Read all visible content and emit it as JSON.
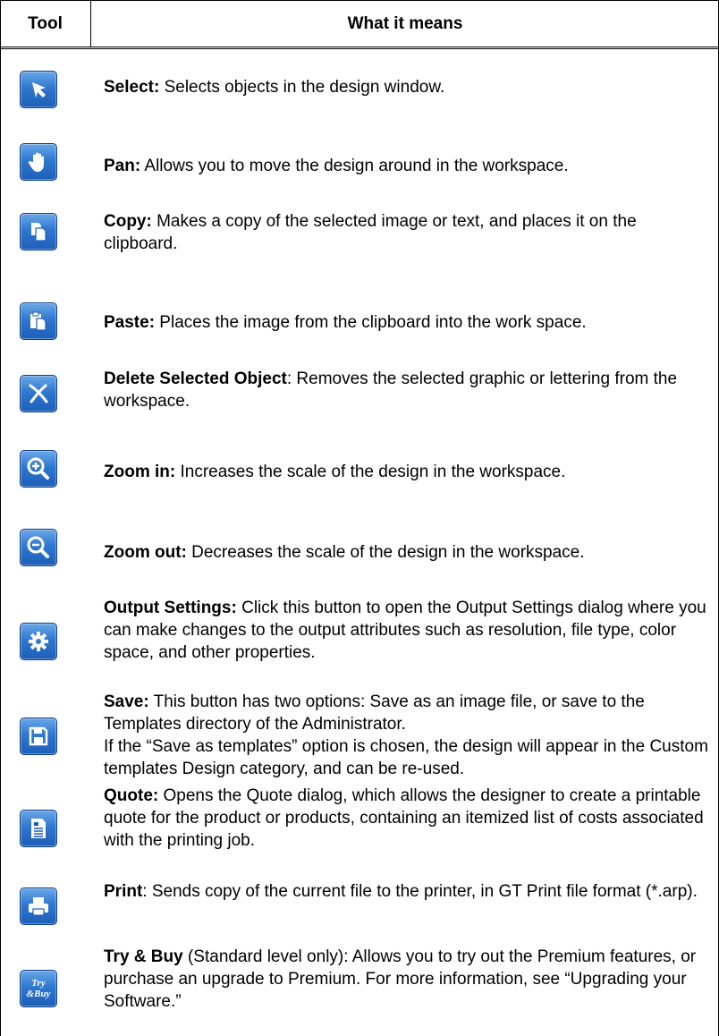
{
  "header": {
    "col1": "Tool",
    "col2": "What it means"
  },
  "rows": [
    {
      "icon": "select-arrow-icon",
      "title": "Select:",
      "text": " Selects objects in the design window."
    },
    {
      "icon": "pan-hand-icon",
      "title": "Pan:",
      "text": " Allows you to move the design around in the workspace."
    },
    {
      "icon": "copy-pages-icon",
      "title": "Copy:",
      "text": " Makes a copy of the selected image or text, and places it on the clipboard."
    },
    {
      "icon": "paste-clipboard-icon",
      "title": "Paste:",
      "text": " Places the image from the clipboard into the work space."
    },
    {
      "icon": "delete-x-icon",
      "title": "Delete Selected Object",
      "text": ": Removes the selected graphic or lettering from the workspace."
    },
    {
      "icon": "zoom-in-icon",
      "title": "Zoom in:",
      "text": " Increases the scale of the design in the workspace."
    },
    {
      "icon": "zoom-out-icon",
      "title": "Zoom out:",
      "text": " Decreases the scale of the design in the workspace."
    },
    {
      "icon": "gear-icon",
      "title": "Output Settings:",
      "text": " Click this button to open the Output Settings dialog where you can make changes to the output attributes such as resolution, file type, color space, and other properties."
    },
    {
      "icon": "floppy-disk-icon",
      "title": "Save:",
      "text": " This button has two options: Save as an image file, or save to the Templates directory of the Administrator.",
      "text2": "If the “Save as templates” option is chosen, the design will appear in the Custom templates Design category, and can be re-used."
    },
    {
      "icon": "quote-document-icon",
      "title": "Quote:",
      "text": " Opens the Quote dialog, which allows the designer to create a printable quote for the product or products, containing an itemized list of costs associated with the printing job."
    },
    {
      "icon": "printer-icon",
      "title": "Print",
      "text": ": Sends copy of the current file to the printer, in GT Print file format (*.arp)."
    },
    {
      "icon": "try-buy-icon",
      "icon_text_1": "Try",
      "icon_text_2": "&Buy",
      "title": "Try & Buy",
      "text": " (Standard level only): Allows you to try out the Premium features, or purchase an upgrade to Premium. For more information, see “Upgrading your Software.”"
    }
  ]
}
